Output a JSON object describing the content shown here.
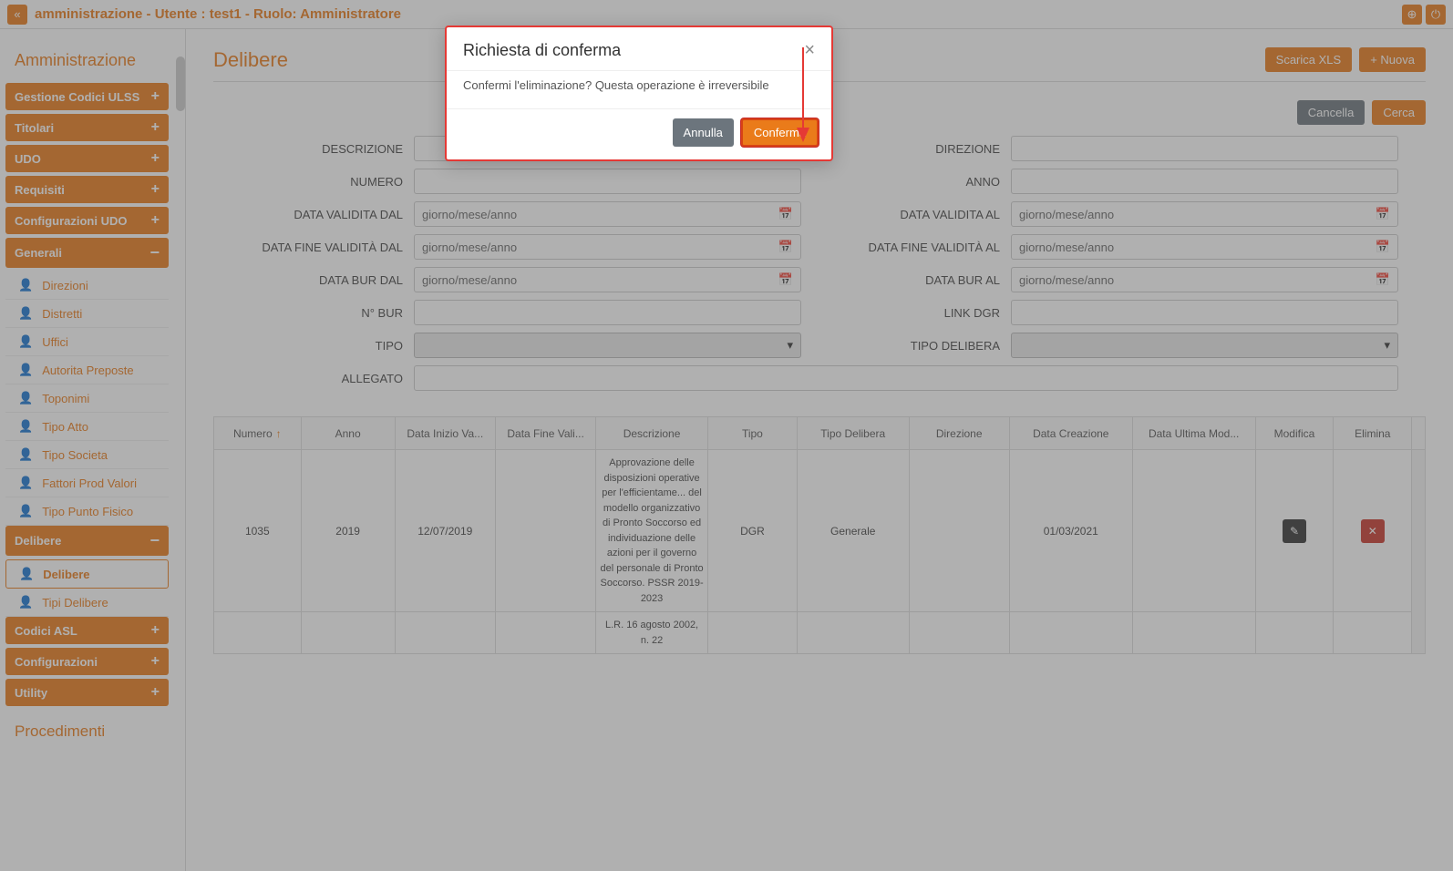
{
  "header": {
    "title": "amministrazione - Utente : test1 - Ruolo: Amministratore"
  },
  "sidebar": {
    "title": "Amministrazione",
    "groups": [
      {
        "label": "Gestione Codici ULSS",
        "icon": "plus"
      },
      {
        "label": "Titolari",
        "icon": "plus"
      },
      {
        "label": "UDO",
        "icon": "plus"
      },
      {
        "label": "Requisiti",
        "icon": "plus"
      },
      {
        "label": "Configurazioni UDO",
        "icon": "plus"
      },
      {
        "label": "Generali",
        "icon": "minus",
        "expanded": true,
        "items": [
          "Direzioni",
          "Distretti",
          "Uffici",
          "Autorita Preposte",
          "Toponimi",
          "Tipo Atto",
          "Tipo Societa",
          "Fattori Prod Valori",
          "Tipo Punto Fisico"
        ]
      },
      {
        "label": "Delibere",
        "icon": "minus",
        "expanded": true,
        "items": [
          "Delibere",
          "Tipi Delibere"
        ],
        "active_item": 0
      },
      {
        "label": "Codici ASL",
        "icon": "plus"
      },
      {
        "label": "Configurazioni",
        "icon": "plus"
      },
      {
        "label": "Utility",
        "icon": "plus"
      }
    ],
    "footer_title": "Procedimenti"
  },
  "page": {
    "title": "Delibere",
    "btn_xls": "Scarica XLS",
    "btn_new": "+  Nuova",
    "btn_cancel": "Cancella",
    "btn_search": "Cerca"
  },
  "form": {
    "labels": {
      "descrizione": "DESCRIZIONE",
      "direzione": "DIREZIONE",
      "numero": "NUMERO",
      "anno": "ANNO",
      "data_val_dal": "DATA VALIDITA DAL",
      "data_val_al": "DATA VALIDITA AL",
      "data_fine_dal": "DATA FINE VALIDITÀ DAL",
      "data_fine_al": "DATA FINE VALIDITÀ AL",
      "data_bur_dal": "DATA BUR DAL",
      "data_bur_al": "DATA BUR AL",
      "n_bur": "N° BUR",
      "link_dgr": "LINK DGR",
      "tipo": "TIPO",
      "tipo_delibera": "TIPO DELIBERA",
      "allegato": "ALLEGATO"
    },
    "date_placeholder": "giorno/mese/anno"
  },
  "table": {
    "headers": [
      "Numero",
      "Anno",
      "Data Inizio Va...",
      "Data Fine Vali...",
      "Descrizione",
      "Tipo",
      "Tipo Delibera",
      "Direzione",
      "Data Creazione",
      "Data Ultima Mod...",
      "Modifica",
      "Elimina"
    ],
    "rows": [
      {
        "numero": "1035",
        "anno": "2019",
        "inizio": "12/07/2019",
        "fine": "",
        "descr": "Approvazione delle disposizioni operative per l'efficientame... del modello organizzativo di Pronto Soccorso ed individuazione delle azioni per il governo del personale di Pronto Soccorso. PSSR 2019-2023",
        "tipo": "DGR",
        "tipodel": "Generale",
        "dir": "",
        "creato": "01/03/2021",
        "mod": ""
      },
      {
        "numero": "",
        "anno": "",
        "inizio": "",
        "fine": "",
        "descr": "L.R. 16 agosto 2002, n. 22",
        "tipo": "",
        "tipodel": "",
        "dir": "",
        "creato": "",
        "mod": ""
      }
    ]
  },
  "modal": {
    "title": "Richiesta di conferma",
    "body": "Confermi l'eliminazione? Questa operazione è irreversibile",
    "btn_cancel": "Annulla",
    "btn_confirm": "Conferma"
  }
}
